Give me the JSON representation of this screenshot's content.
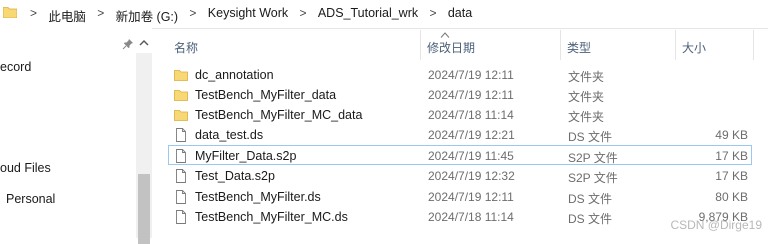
{
  "address": {
    "crumbs": [
      "此电脑",
      "新加卷 (G:)",
      "Keysight Work",
      "ADS_Tutorial_wrk",
      "data"
    ],
    "separator": ">"
  },
  "nav": {
    "items": [
      "ecord",
      "oud Files",
      "Personal"
    ]
  },
  "columns": {
    "name": "名称",
    "date": "修改日期",
    "type": "类型",
    "size": "大小"
  },
  "files": [
    {
      "name": "dc_annotation",
      "date": "2024/7/19 12:11",
      "type": "文件夹",
      "size": "",
      "icon": "folder-icon"
    },
    {
      "name": "TestBench_MyFilter_data",
      "date": "2024/7/19 12:11",
      "type": "文件夹",
      "size": "",
      "icon": "folder-icon"
    },
    {
      "name": "TestBench_MyFilter_MC_data",
      "date": "2024/7/18 11:14",
      "type": "文件夹",
      "size": "",
      "icon": "folder-icon"
    },
    {
      "name": "data_test.ds",
      "date": "2024/7/19 12:21",
      "type": "DS 文件",
      "size": "49 KB",
      "icon": "file-icon"
    },
    {
      "name": "MyFilter_Data.s2p",
      "date": "2024/7/19 11:45",
      "type": "S2P 文件",
      "size": "17 KB",
      "icon": "file-icon"
    },
    {
      "name": "Test_Data.s2p",
      "date": "2024/7/19 12:32",
      "type": "S2P 文件",
      "size": "17 KB",
      "icon": "file-icon"
    },
    {
      "name": "TestBench_MyFilter.ds",
      "date": "2024/7/19 12:11",
      "type": "DS 文件",
      "size": "80 KB",
      "icon": "file-icon"
    },
    {
      "name": "TestBench_MyFilter_MC.ds",
      "date": "2024/7/18 11:14",
      "type": "DS 文件",
      "size": "9,879 KB",
      "icon": "file-icon"
    }
  ],
  "watermark": "CSDN @Dirge19",
  "colors": {
    "folder": "#f8d775",
    "selection_border": "#99c9ef",
    "header_text": "#4c607a"
  }
}
